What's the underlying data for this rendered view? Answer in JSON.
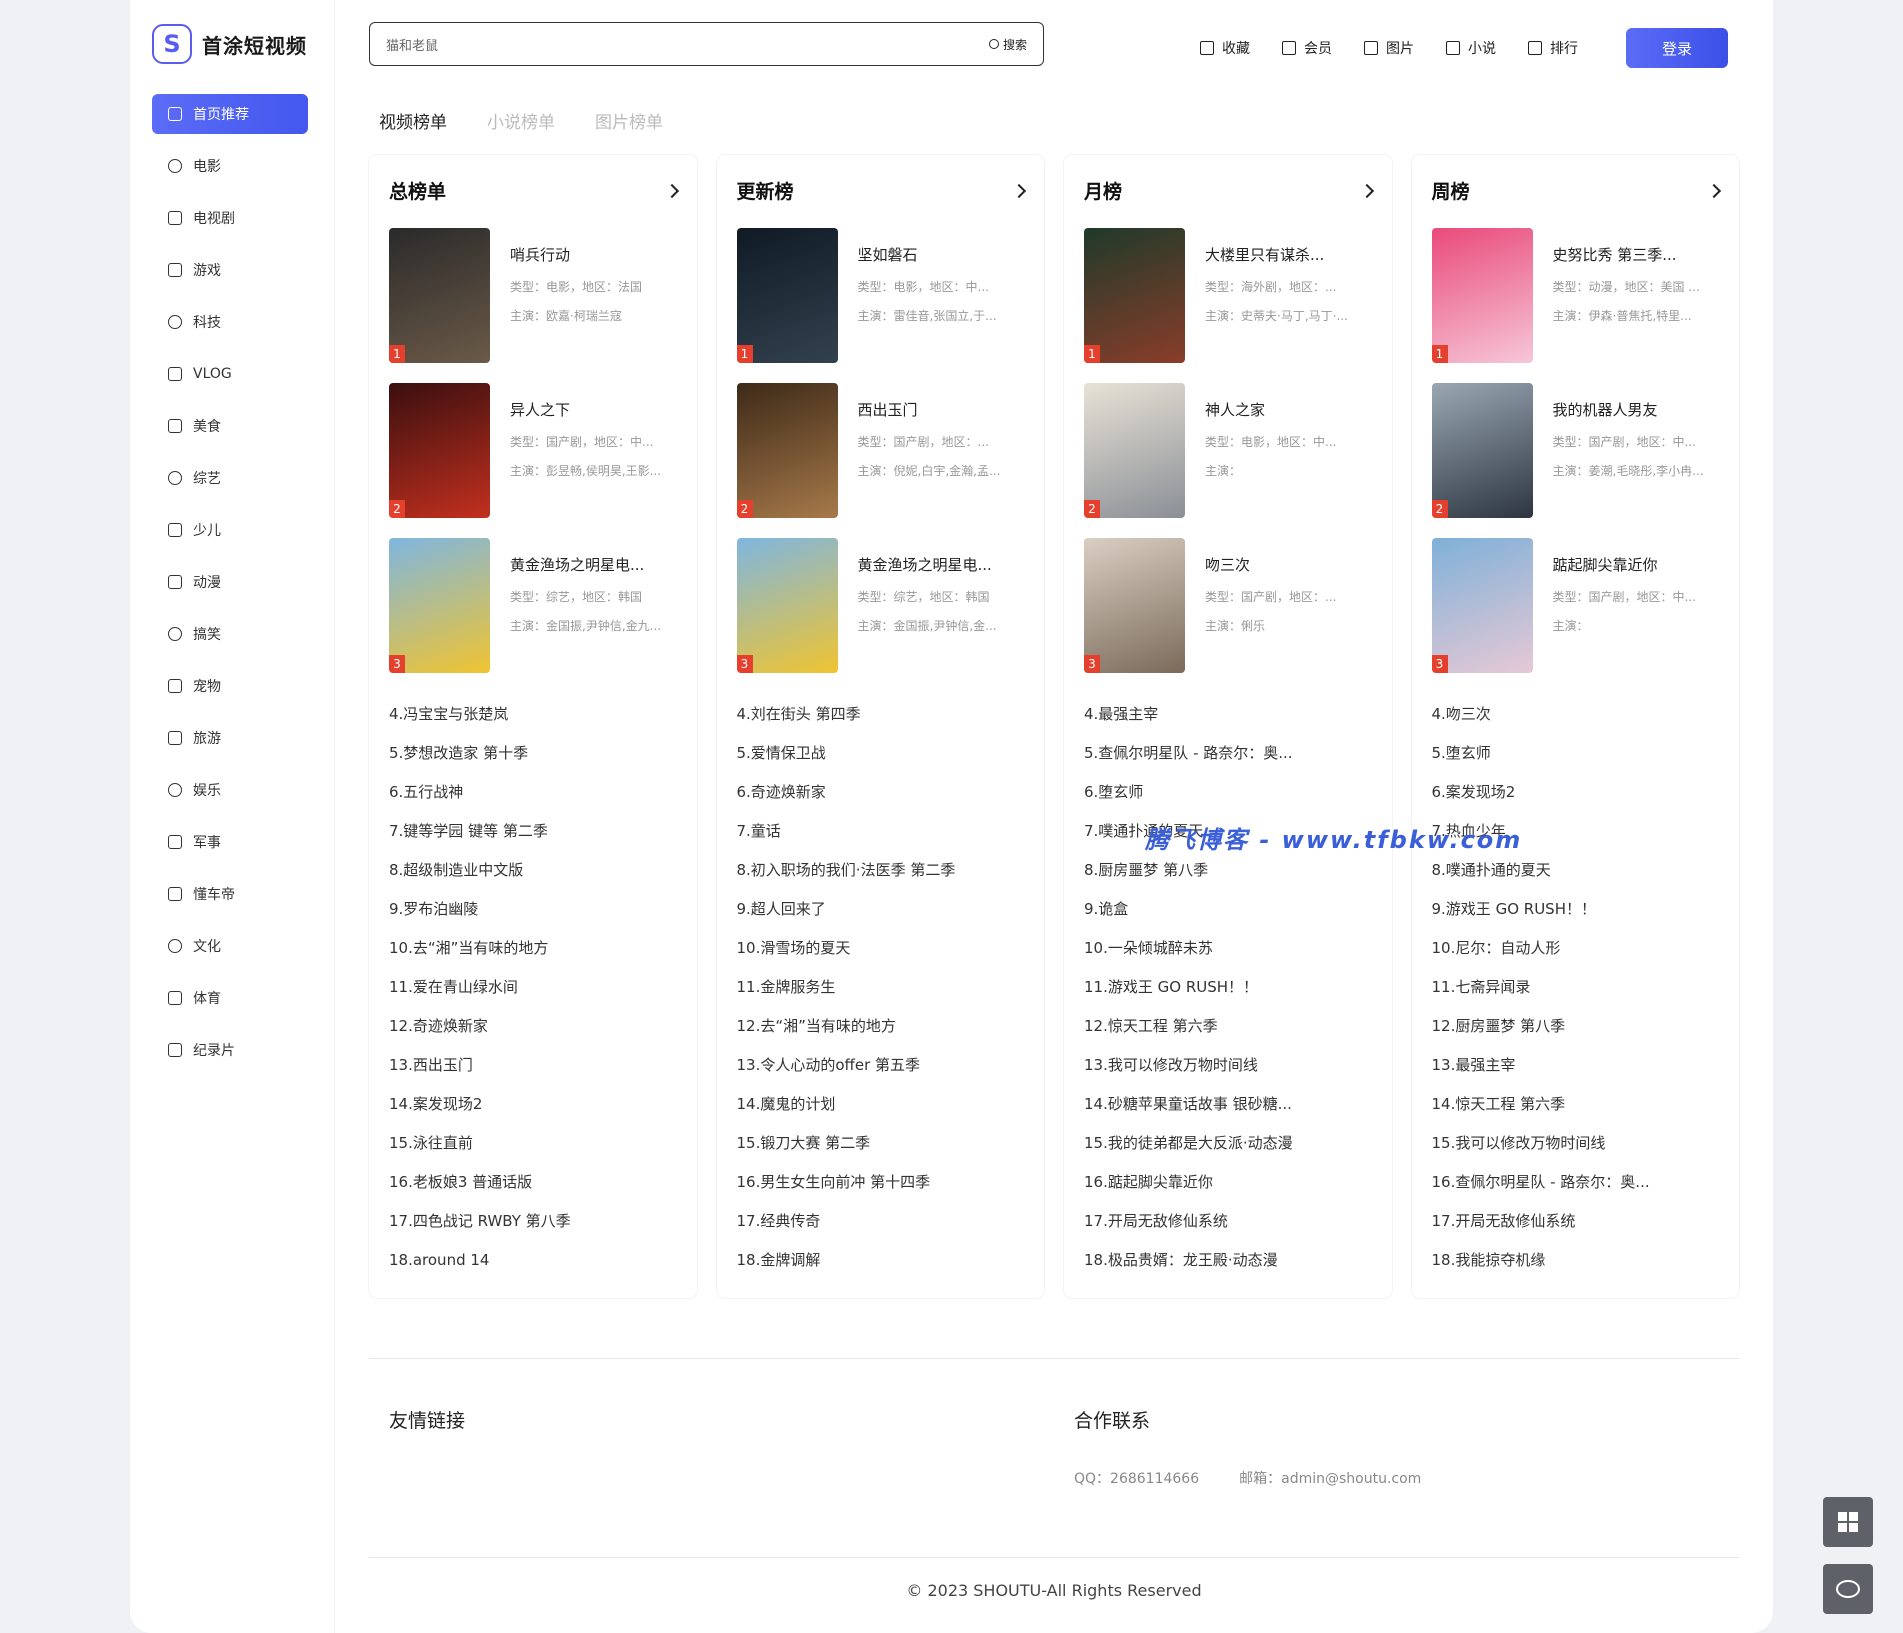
{
  "brand": {
    "name": "首涂短视频",
    "logo_letter": "S"
  },
  "sidebar": {
    "items": [
      {
        "label": "首页推荐",
        "icon": "home-icon",
        "active": true
      },
      {
        "label": "电影",
        "icon": "film-reel-icon"
      },
      {
        "label": "电视剧",
        "icon": "tv-icon"
      },
      {
        "label": "游戏",
        "icon": "gamepad-icon"
      },
      {
        "label": "科技",
        "icon": "chip-icon"
      },
      {
        "label": "VLOG",
        "icon": "video-camera-icon"
      },
      {
        "label": "美食",
        "icon": "food-icon"
      },
      {
        "label": "综艺",
        "icon": "variety-icon"
      },
      {
        "label": "少儿",
        "icon": "kids-icon"
      },
      {
        "label": "动漫",
        "icon": "anime-icon"
      },
      {
        "label": "搞笑",
        "icon": "smile-icon"
      },
      {
        "label": "宠物",
        "icon": "pet-icon"
      },
      {
        "label": "旅游",
        "icon": "travel-icon"
      },
      {
        "label": "娱乐",
        "icon": "entertainment-icon"
      },
      {
        "label": "军事",
        "icon": "military-icon"
      },
      {
        "label": "懂车帝",
        "icon": "car-icon"
      },
      {
        "label": "文化",
        "icon": "book-icon"
      },
      {
        "label": "体育",
        "icon": "ball-icon"
      },
      {
        "label": "纪录片",
        "icon": "documentary-icon"
      }
    ]
  },
  "search": {
    "value": "猫和老鼠",
    "button": "搜索"
  },
  "topnav": [
    {
      "label": "收藏",
      "icon": "bookmark-icon"
    },
    {
      "label": "会员",
      "icon": "diamond-icon"
    },
    {
      "label": "图片",
      "icon": "image-icon"
    },
    {
      "label": "小说",
      "icon": "book-icon"
    },
    {
      "label": "排行",
      "icon": "bar-chart-icon"
    }
  ],
  "login": "登录",
  "tabs": [
    {
      "label": "视频榜单",
      "active": true
    },
    {
      "label": "小说榜单"
    },
    {
      "label": "图片榜单"
    }
  ],
  "cards": [
    {
      "title": "总榜单",
      "top": [
        {
          "rank": "1",
          "title": "哨兵行动",
          "meta": "类型：电影，地区：法国",
          "cast": "主演：欧嘉·柯瑞兰寇",
          "color1": "#2a2a2a",
          "color2": "#6b5a48"
        },
        {
          "rank": "2",
          "title": "异人之下",
          "meta": "类型：国产剧，地区：中...",
          "cast": "主演：彭昱畅,侯明昊,王影...",
          "color1": "#3a0f0f",
          "color2": "#c2301f"
        },
        {
          "rank": "3",
          "title": "黄金渔场之明星电...",
          "meta": "类型：综艺，地区：韩国",
          "cast": "主演：金国振,尹钟信,金九...",
          "color1": "#7fb6e0",
          "color2": "#f0c430"
        }
      ],
      "list": [
        "4.冯宝宝与张楚岚",
        "5.梦想改造家 第十季",
        "6.五行战神",
        "7.键等学园 键等 第二季",
        "8.超级制造业中文版",
        "9.罗布泊幽陵",
        "10.去“湘”当有味的地方",
        "11.爱在青山绿水间",
        "12.奇迹焕新家",
        "13.西出玉门",
        "14.案发现场2",
        "15.泳往直前",
        "16.老板娘3 普通话版",
        "17.四色战记 RWBY 第八季",
        "18.around 14"
      ]
    },
    {
      "title": "更新榜",
      "top": [
        {
          "rank": "1",
          "title": "坚如磐石",
          "meta": "类型：电影，地区：中...",
          "cast": "主演：雷佳音,张国立,于...",
          "color1": "#0f1a24",
          "color2": "#33414f"
        },
        {
          "rank": "2",
          "title": "西出玉门",
          "meta": "类型：国产剧，地区：...",
          "cast": "主演：倪妮,白宇,金瀚,孟...",
          "color1": "#3d2a18",
          "color2": "#a7794a"
        },
        {
          "rank": "3",
          "title": "黄金渔场之明星电...",
          "meta": "类型：综艺，地区：韩国",
          "cast": "主演：金国振,尹钟信,金...",
          "color1": "#7fb6e0",
          "color2": "#f0c430"
        }
      ],
      "list": [
        "4.刘在街头 第四季",
        "5.爱情保卫战",
        "6.奇迹焕新家",
        "7.童话",
        "8.初入职场的我们·法医季 第二季",
        "9.超人回来了",
        "10.滑雪场的夏天",
        "11.金牌服务生",
        "12.去“湘”当有味的地方",
        "13.令人心动的offer 第五季",
        "14.魔鬼的计划",
        "15.锻刀大赛 第二季",
        "16.男生女生向前冲 第十四季",
        "17.经典传奇",
        "18.金牌调解"
      ]
    },
    {
      "title": "月榜",
      "top": [
        {
          "rank": "1",
          "title": "大楼里只有谋杀...",
          "meta": "类型：海外剧，地区：...",
          "cast": "主演：史蒂夫·马丁,马丁·...",
          "color1": "#1f3a2a",
          "color2": "#8a3d2a"
        },
        {
          "rank": "2",
          "title": "神人之家",
          "meta": "类型：电影，地区：中...",
          "cast": "主演：",
          "color1": "#e8e2d6",
          "color2": "#8a8f96"
        },
        {
          "rank": "3",
          "title": "吻三次",
          "meta": "类型：国产剧，地区：...",
          "cast": "主演：俐乐",
          "color1": "#d9cfc2",
          "color2": "#7b6a5a"
        }
      ],
      "list": [
        "4.最强主宰",
        "5.查佩尔明星队 - 路奈尔：奥...",
        "6.堕玄师",
        "7.噗通扑通的夏天",
        "8.厨房噩梦 第八季",
        "9.诡盒",
        "10.一朵倾城醉未苏",
        "11.游戏王 GO RUSH！！",
        "12.惊天工程 第六季",
        "13.我可以修改万物时间线",
        "14.砂糖苹果童话故事 银砂糖...",
        "15.我的徒弟都是大反派·动态漫",
        "16.踮起脚尖靠近你",
        "17.开局无敌修仙系统",
        "18.极品贵婿：龙王殿·动态漫"
      ]
    },
    {
      "title": "周榜",
      "top": [
        {
          "rank": "1",
          "title": "史努比秀 第三季...",
          "meta": "类型：动漫，地区：美国 ...",
          "cast": "主演：伊森·普焦托,特里...",
          "color1": "#e94a7a",
          "color2": "#f6c6d8"
        },
        {
          "rank": "2",
          "title": "我的机器人男友",
          "meta": "类型：国产剧，地区：中...",
          "cast": "主演：姜潮,毛晓彤,李小冉...",
          "color1": "#9aa7b3",
          "color2": "#2d3640"
        },
        {
          "rank": "3",
          "title": "踮起脚尖靠近你",
          "meta": "类型：国产剧，地区：中...",
          "cast": "主演：",
          "color1": "#7fb0d8",
          "color2": "#e6c9d5"
        }
      ],
      "list": [
        "4.吻三次",
        "5.堕玄师",
        "6.案发现场2",
        "7.热血少年",
        "8.噗通扑通的夏天",
        "9.游戏王 GO RUSH！！",
        "10.尼尔：自动人形",
        "11.七斋异闻录",
        "12.厨房噩梦 第八季",
        "13.最强主宰",
        "14.惊天工程 第六季",
        "15.我可以修改万物时间线",
        "16.查佩尔明星队 - 路奈尔：奥...",
        "17.开局无敌修仙系统",
        "18.我能掠夺机缘"
      ]
    }
  ],
  "footer": {
    "links_title": "友情链接",
    "contact_title": "合作联系",
    "qq": "QQ：2686114666",
    "email": "邮箱：admin@shoutu.com",
    "copyright": "© 2023 SHOUTU-All Rights Reserved"
  },
  "watermark": "腾飞博客 - www.tfbkw.com"
}
